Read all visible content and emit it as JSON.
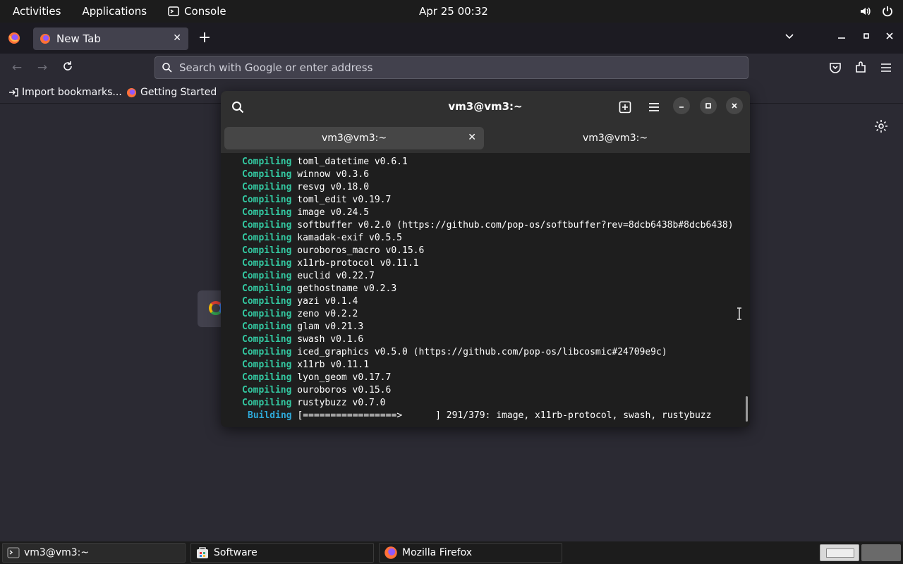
{
  "topbar": {
    "activities": "Activities",
    "applications": "Applications",
    "console": "Console",
    "clock": "Apr 25  00:32"
  },
  "firefox": {
    "tab_label": "New Tab",
    "url_placeholder": "Search with Google or enter address",
    "bookmarks": [
      "Import bookmarks...",
      "Getting Started"
    ]
  },
  "terminal": {
    "title": "vm3@vm3:~",
    "tabs": [
      "vm3@vm3:~",
      "vm3@vm3:~"
    ],
    "lines": [
      {
        "kw": "Compiling",
        "text": "toml_datetime v0.6.1"
      },
      {
        "kw": "Compiling",
        "text": "winnow v0.3.6"
      },
      {
        "kw": "Compiling",
        "text": "resvg v0.18.0"
      },
      {
        "kw": "Compiling",
        "text": "toml_edit v0.19.7"
      },
      {
        "kw": "Compiling",
        "text": "image v0.24.5"
      },
      {
        "kw": "Compiling",
        "text": "softbuffer v0.2.0 (https://github.com/pop-os/softbuffer?rev=8dcb6438b#8dcb6438)"
      },
      {
        "kw": "Compiling",
        "text": "kamadak-exif v0.5.5"
      },
      {
        "kw": "Compiling",
        "text": "ouroboros_macro v0.15.6"
      },
      {
        "kw": "Compiling",
        "text": "x11rb-protocol v0.11.1"
      },
      {
        "kw": "Compiling",
        "text": "euclid v0.22.7"
      },
      {
        "kw": "Compiling",
        "text": "gethostname v0.2.3"
      },
      {
        "kw": "Compiling",
        "text": "yazi v0.1.4"
      },
      {
        "kw": "Compiling",
        "text": "zeno v0.2.2"
      },
      {
        "kw": "Compiling",
        "text": "glam v0.21.3"
      },
      {
        "kw": "Compiling",
        "text": "swash v0.1.6"
      },
      {
        "kw": "Compiling",
        "text": "iced_graphics v0.5.0 (https://github.com/pop-os/libcosmic#24709e9c)"
      },
      {
        "kw": "Compiling",
        "text": "x11rb v0.11.1"
      },
      {
        "kw": "Compiling",
        "text": "lyon_geom v0.17.7"
      },
      {
        "kw": "Compiling",
        "text": "ouroboros v0.15.6"
      },
      {
        "kw": "Compiling",
        "text": "rustybuzz v0.7.0"
      }
    ],
    "building": {
      "kw": "Building",
      "text": "[=================>      ] 291/379: image, x11rb-protocol, swash, rustybuzz"
    }
  },
  "taskbar": {
    "tasks": [
      "vm3@vm3:~",
      "Software",
      "Mozilla Firefox"
    ]
  }
}
